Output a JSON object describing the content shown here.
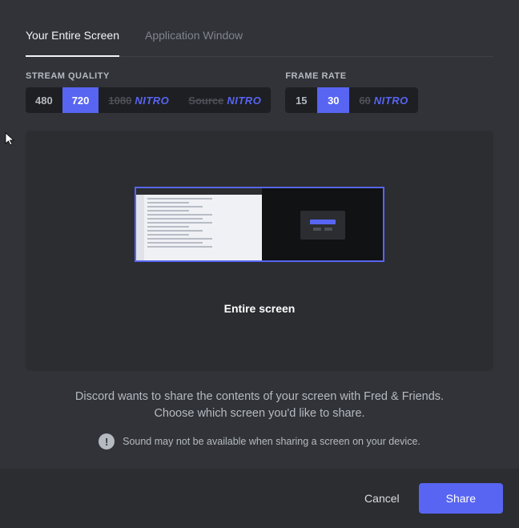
{
  "tabs": {
    "entire_screen": "Your Entire Screen",
    "app_window": "Application Window"
  },
  "quality": {
    "label": "Stream Quality",
    "opt_480": "480",
    "opt_720": "720",
    "opt_1080": "1080",
    "opt_source": "Source",
    "nitro": "NITRO"
  },
  "framerate": {
    "label": "Frame Rate",
    "opt_15": "15",
    "opt_30": "30",
    "opt_60": "60",
    "nitro": "NITRO"
  },
  "preview": {
    "label": "Entire screen"
  },
  "info": {
    "line1": "Discord wants to share the contents of your screen with Fred & Friends.",
    "line2": "Choose which screen you'd like to share.",
    "sound_warning": "Sound may not be available when sharing a screen on your device."
  },
  "footer": {
    "cancel": "Cancel",
    "share": "Share"
  }
}
